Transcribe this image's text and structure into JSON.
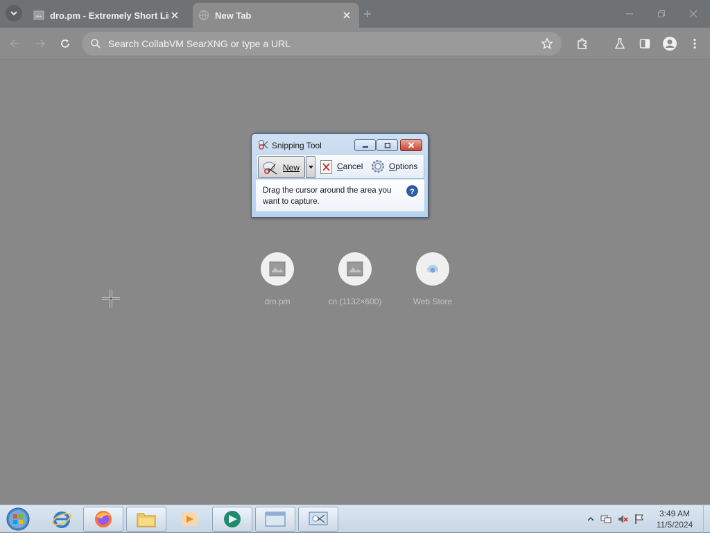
{
  "browser": {
    "tabs": [
      {
        "title": "dro.pm - Extremely Short Link",
        "active": false
      },
      {
        "title": "New Tab",
        "active": true
      }
    ],
    "omnibox": {
      "placeholder": "Search CollabVM SearXNG or type a URL"
    }
  },
  "newtab": {
    "shortcuts": [
      {
        "label": "dro.pm"
      },
      {
        "label": "cn (1132×600)"
      },
      {
        "label": "Web Store"
      }
    ]
  },
  "snipping_tool": {
    "title": "Snipping Tool",
    "new_label": "New",
    "cancel_label": "Cancel",
    "options_label": "Options",
    "message": "Drag the cursor around the area you want to capture."
  },
  "taskbar": {
    "clock_time": "3:49 AM",
    "clock_date": "11/5/2024"
  },
  "colors": {
    "overlay": "#888888",
    "snip_frame": "#b9d1ec",
    "close_red": "#c74533"
  }
}
